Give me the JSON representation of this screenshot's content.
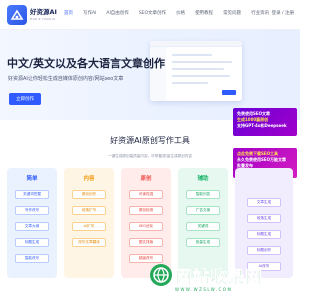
{
  "nav": {
    "brand": "好资源AI",
    "brand_sub": "HAO Z YUAN AI",
    "menu": [
      "首页",
      "写作AI",
      "AI自由创作",
      "SEO文章创作",
      "价格",
      "使用教程",
      "常见问题",
      "行业资讯"
    ],
    "active_index": 0,
    "login": "登录 / 注册"
  },
  "hero": {
    "title": "中文/英文以及各大语言文章创作",
    "subtitle": "好资源AI让你轻松生成自媒体原创内容/网站seo文章",
    "button": "立即创作"
  },
  "ads": [
    {
      "lines": [
        "免费使用SEO文章",
        "生成1000篇原创",
        "支持GPT-4o和Deepseek"
      ]
    },
    {
      "lines": [
        "点此免费下载SEO工具",
        "永久免费使用SEO万能文章",
        "批量发布"
      ]
    }
  ],
  "section": {
    "title": "好资源AI原创写作工具",
    "subtitle": "一键生成原创高质量内容，可掌握/批量生成原创内容"
  },
  "columns": [
    {
      "title": "简单",
      "items": [
        "关键词挖掘",
        "写作改写",
        "文章大纲",
        "标题生成",
        "智能改写"
      ]
    },
    {
      "title": "内容",
      "items": [
        "原创创作",
        "段落扩写",
        "AI扩写",
        "改写文章翻译"
      ]
    },
    {
      "title": "原创",
      "items": [
        "可读性强",
        "原创检测",
        "SEO优化",
        "图文排版",
        "超级改写"
      ]
    },
    {
      "title": "辅助",
      "items": [
        "智能问答",
        "广告文案",
        "关键词",
        "批量生成"
      ]
    },
    {
      "title": "",
      "items": [
        "文章生成",
        "段落生成",
        "标题生成",
        "标题创作",
        "AI改写"
      ]
    }
  ],
  "watermark": {
    "text": "网站收录网",
    "url": "WWW.WZSLW.COM"
  },
  "colors": {
    "primary": "#2f5bff",
    "watermark": "#24a85a"
  }
}
